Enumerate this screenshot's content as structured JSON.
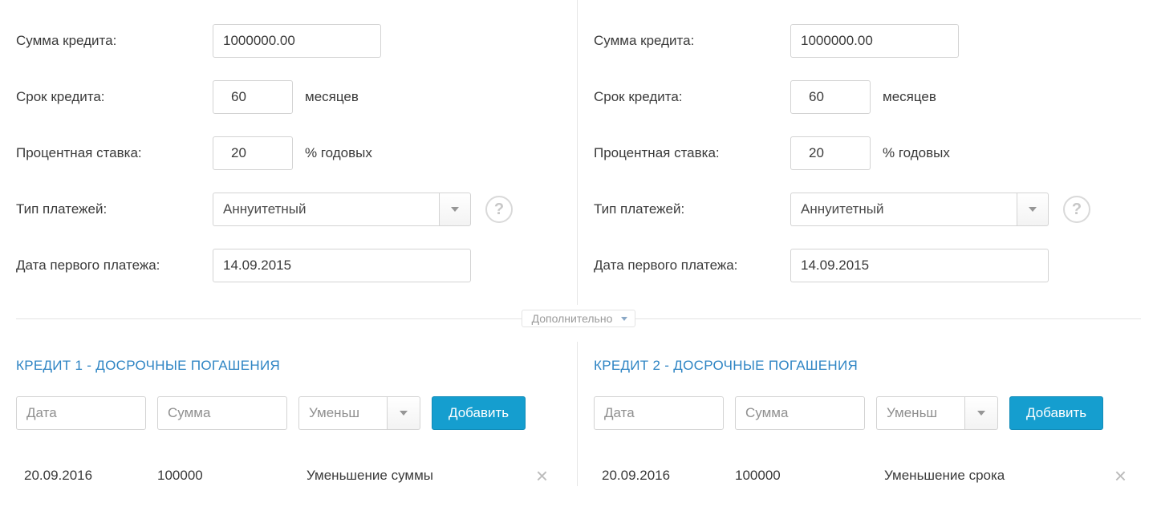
{
  "labels": {
    "loan_amount": "Сумма кредита:",
    "loan_term": "Срок кредита:",
    "interest_rate": "Процентная ставка:",
    "payment_type": "Тип платежей:",
    "first_payment_date": "Дата первого платежа:",
    "months_suffix": "месяцев",
    "rate_suffix": "% годовых",
    "divider": "Дополнительно",
    "add_button": "Добавить",
    "placeholders": {
      "date": "Дата",
      "sum": "Сумма",
      "reduce": "Уменьш"
    }
  },
  "left": {
    "amount": "1000000.00",
    "term": "60",
    "rate": "20",
    "payment_type": "Аннуитетный",
    "first_date": "14.09.2015",
    "section_title": "КРЕДИТ 1 - ДОСРОЧНЫЕ ПОГАШЕНИЯ",
    "entry": {
      "date": "20.09.2016",
      "sum": "100000",
      "type": "Уменьшение суммы"
    }
  },
  "right": {
    "amount": "1000000.00",
    "term": "60",
    "rate": "20",
    "payment_type": "Аннуитетный",
    "first_date": "14.09.2015",
    "section_title": "КРЕДИТ 2 - ДОСРОЧНЫЕ ПОГАШЕНИЯ",
    "entry": {
      "date": "20.09.2016",
      "sum": "100000",
      "type": "Уменьшение срока"
    }
  }
}
